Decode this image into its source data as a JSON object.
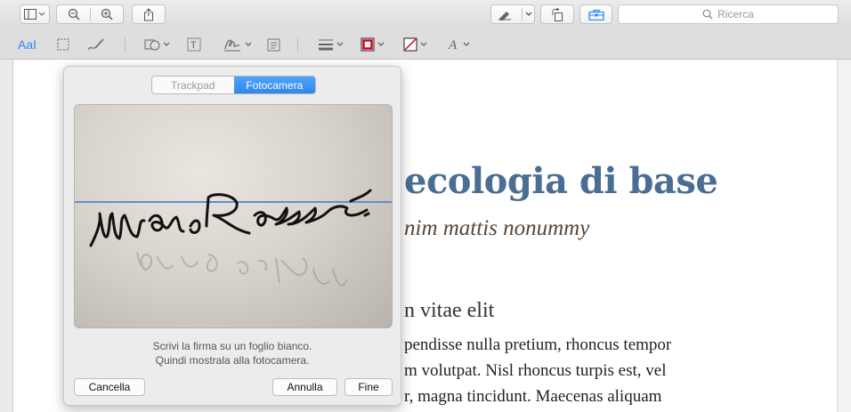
{
  "toolbar": {
    "search_placeholder": "Ricerca"
  },
  "document": {
    "title": "ecologia di base",
    "subtitle": "nim mattis nonummy",
    "heading": "n vitae elit",
    "paragraph_lines": [
      "pendisse nulla pretium, rhoncus tempor",
      "m volutpat. Nisl rhoncus turpis est, vel",
      "r, magna tincidunt. Maecenas aliquam"
    ]
  },
  "signature_popover": {
    "tabs": [
      {
        "label": "Trackpad",
        "selected": false
      },
      {
        "label": "Fotocamera",
        "selected": true
      }
    ],
    "hint_lines": [
      "Scrivi la firma su un foglio bianco.",
      "Quindi mostrala alla fotocamera."
    ],
    "buttons": {
      "clear": "Cancella",
      "cancel": "Annulla",
      "done": "Fine"
    }
  },
  "colors": {
    "accent": "#2d87ee",
    "title": "#4a6d94",
    "rect_stroke": "#d0021b",
    "guide_line": "#5f8ed6"
  }
}
